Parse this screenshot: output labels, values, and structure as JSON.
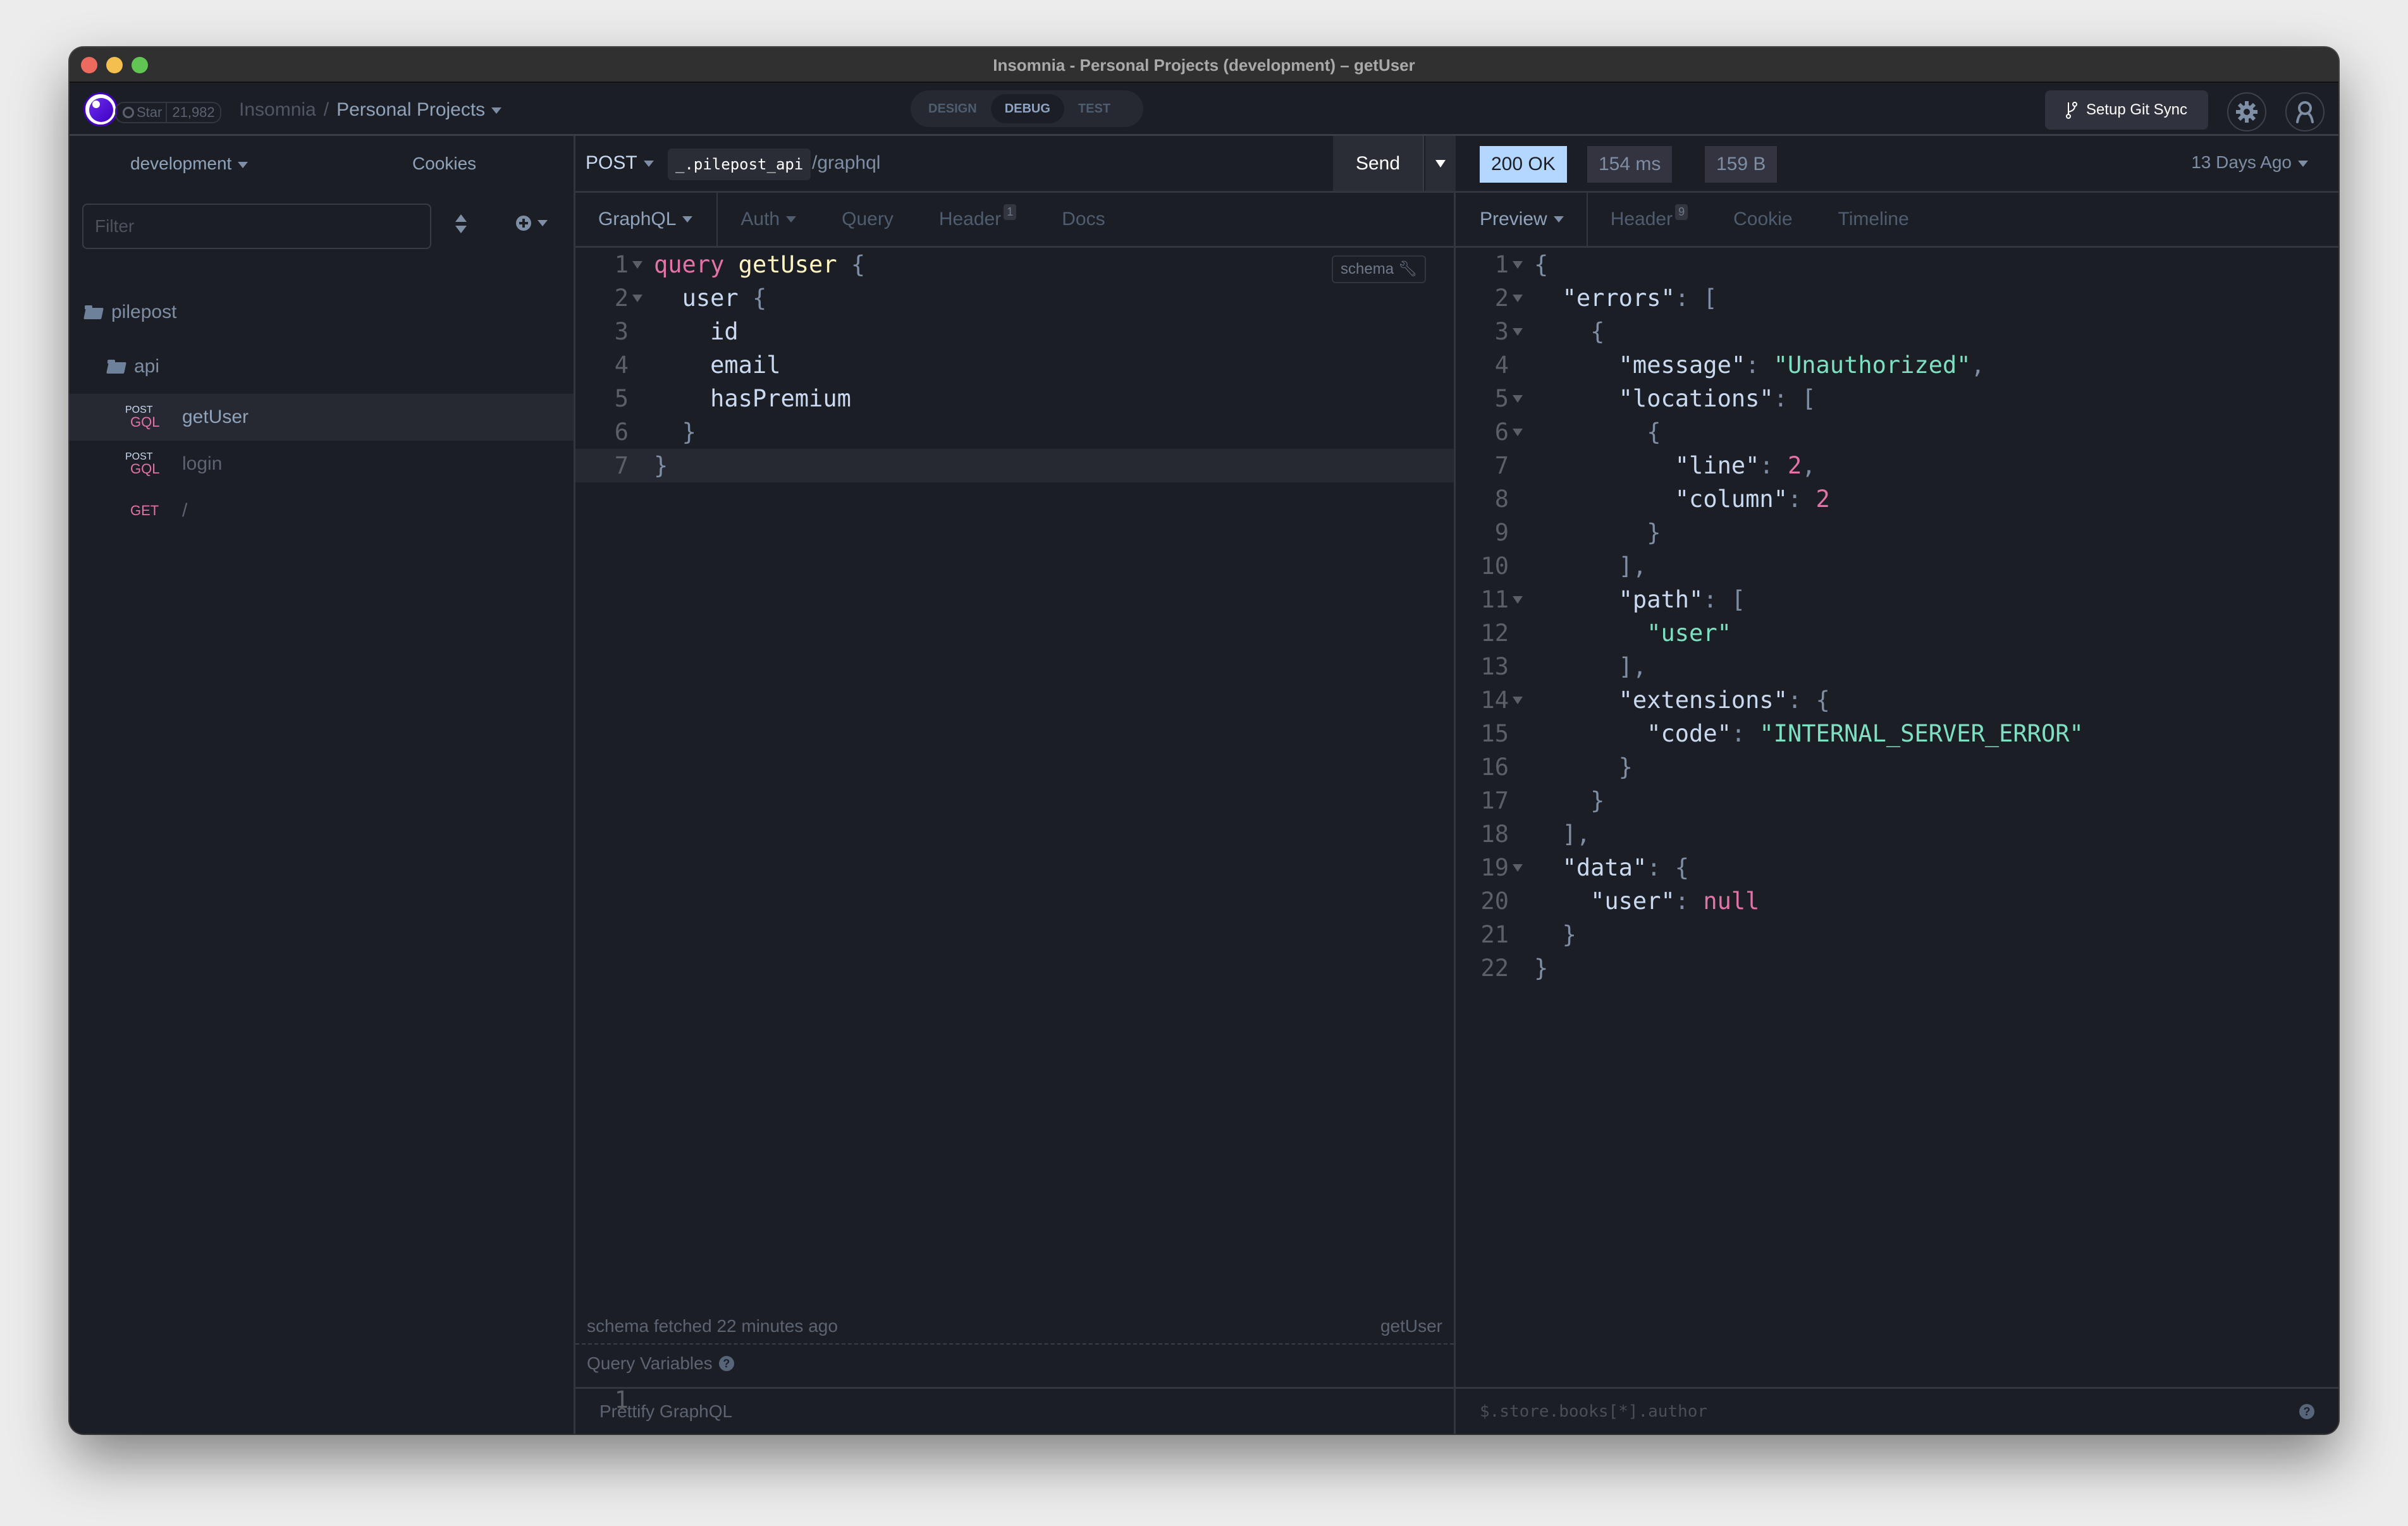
{
  "window": {
    "title": "Insomnia - Personal Projects (development) – getUser"
  },
  "header": {
    "github": {
      "label": "Star",
      "count": "21,982"
    },
    "breadcrumb": {
      "root": "Insomnia",
      "separator": "/",
      "current": "Personal Projects"
    },
    "modes": [
      {
        "label": "DESIGN",
        "active": false
      },
      {
        "label": "DEBUG",
        "active": true
      },
      {
        "label": "TEST",
        "active": false
      }
    ],
    "git_sync_label": "Setup Git Sync",
    "settings_icon": "gear-icon",
    "account_icon": "user-icon"
  },
  "sidebar": {
    "environment": "development",
    "cookies_label": "Cookies",
    "filter_placeholder": "Filter",
    "tree": {
      "workspace_folder": "pilepost",
      "sub_folder": "api",
      "requests": [
        {
          "method_top": "POST",
          "method_bottom": "GQL",
          "name": "getUser",
          "active": true
        },
        {
          "method_top": "POST",
          "method_bottom": "GQL",
          "name": "login",
          "active": false
        },
        {
          "method_top": "",
          "method_bottom": "GET",
          "name": "/",
          "active": false
        }
      ]
    }
  },
  "request": {
    "method": "POST",
    "env_var": "_.pilepost_api",
    "path": "/graphql",
    "send_label": "Send",
    "tabs": [
      {
        "label": "GraphQL",
        "dropdown": true
      },
      {
        "label": "Auth",
        "dropdown": true
      },
      {
        "label": "Query"
      },
      {
        "label": "Header",
        "badge": "1"
      },
      {
        "label": "Docs"
      }
    ],
    "schema_label": "schema",
    "code": [
      {
        "n": "1",
        "fold": true,
        "tokens": [
          [
            "kw",
            "query"
          ],
          [
            "p",
            " "
          ],
          [
            "fn",
            "getUser"
          ],
          [
            "p",
            " "
          ],
          [
            "punc",
            "{"
          ]
        ]
      },
      {
        "n": "2",
        "fold": true,
        "tokens": [
          [
            "p",
            "  "
          ],
          [
            "prop",
            "user"
          ],
          [
            "p",
            " "
          ],
          [
            "punc",
            "{"
          ]
        ]
      },
      {
        "n": "3",
        "fold": false,
        "tokens": [
          [
            "p",
            "    "
          ],
          [
            "prop",
            "id"
          ]
        ]
      },
      {
        "n": "4",
        "fold": false,
        "tokens": [
          [
            "p",
            "    "
          ],
          [
            "prop",
            "email"
          ]
        ]
      },
      {
        "n": "5",
        "fold": false,
        "tokens": [
          [
            "p",
            "    "
          ],
          [
            "prop",
            "hasPremium"
          ]
        ]
      },
      {
        "n": "6",
        "fold": false,
        "tokens": [
          [
            "p",
            "  "
          ],
          [
            "punc",
            "}"
          ]
        ]
      },
      {
        "n": "7",
        "fold": false,
        "current": true,
        "tokens": [
          [
            "punc",
            "}"
          ]
        ]
      }
    ],
    "schema_status": "schema fetched 22 minutes ago",
    "operation_name": "getUser",
    "query_variables_label": "Query Variables",
    "query_variables_line": "1",
    "prettify_label": "Prettify GraphQL"
  },
  "response": {
    "status": "200 OK",
    "time": "154 ms",
    "size": "159 B",
    "history": "13 Days Ago",
    "status_color": "#b3d7ff",
    "tabs": [
      {
        "label": "Preview",
        "dropdown": true
      },
      {
        "label": "Header",
        "badge": "9"
      },
      {
        "label": "Cookie"
      },
      {
        "label": "Timeline"
      }
    ],
    "code": [
      {
        "n": "1",
        "fold": true,
        "tokens": [
          [
            "punc",
            "{"
          ]
        ]
      },
      {
        "n": "2",
        "fold": true,
        "tokens": [
          [
            "p",
            "  "
          ],
          [
            "prop",
            "\"errors\""
          ],
          [
            "punc",
            ": ["
          ]
        ]
      },
      {
        "n": "3",
        "fold": true,
        "tokens": [
          [
            "p",
            "    "
          ],
          [
            "punc",
            "{"
          ]
        ]
      },
      {
        "n": "4",
        "fold": false,
        "tokens": [
          [
            "p",
            "      "
          ],
          [
            "prop",
            "\"message\""
          ],
          [
            "punc",
            ": "
          ],
          [
            "str",
            "\"Unauthorized\""
          ],
          [
            "punc",
            ","
          ]
        ]
      },
      {
        "n": "5",
        "fold": true,
        "tokens": [
          [
            "p",
            "      "
          ],
          [
            "prop",
            "\"locations\""
          ],
          [
            "punc",
            ": ["
          ]
        ]
      },
      {
        "n": "6",
        "fold": true,
        "tokens": [
          [
            "p",
            "        "
          ],
          [
            "punc",
            "{"
          ]
        ]
      },
      {
        "n": "7",
        "fold": false,
        "tokens": [
          [
            "p",
            "          "
          ],
          [
            "prop",
            "\"line\""
          ],
          [
            "punc",
            ": "
          ],
          [
            "num",
            "2"
          ],
          [
            "punc",
            ","
          ]
        ]
      },
      {
        "n": "8",
        "fold": false,
        "tokens": [
          [
            "p",
            "          "
          ],
          [
            "prop",
            "\"column\""
          ],
          [
            "punc",
            ": "
          ],
          [
            "num",
            "2"
          ]
        ]
      },
      {
        "n": "9",
        "fold": false,
        "tokens": [
          [
            "p",
            "        "
          ],
          [
            "punc",
            "}"
          ]
        ]
      },
      {
        "n": "10",
        "fold": false,
        "tokens": [
          [
            "p",
            "      "
          ],
          [
            "punc",
            "],"
          ]
        ]
      },
      {
        "n": "11",
        "fold": true,
        "tokens": [
          [
            "p",
            "      "
          ],
          [
            "prop",
            "\"path\""
          ],
          [
            "punc",
            ": ["
          ]
        ]
      },
      {
        "n": "12",
        "fold": false,
        "tokens": [
          [
            "p",
            "        "
          ],
          [
            "str",
            "\"user\""
          ]
        ]
      },
      {
        "n": "13",
        "fold": false,
        "tokens": [
          [
            "p",
            "      "
          ],
          [
            "punc",
            "],"
          ]
        ]
      },
      {
        "n": "14",
        "fold": true,
        "tokens": [
          [
            "p",
            "      "
          ],
          [
            "prop",
            "\"extensions\""
          ],
          [
            "punc",
            ": {"
          ]
        ]
      },
      {
        "n": "15",
        "fold": false,
        "tokens": [
          [
            "p",
            "        "
          ],
          [
            "prop",
            "\"code\""
          ],
          [
            "punc",
            ": "
          ],
          [
            "str",
            "\"INTERNAL_SERVER_ERROR\""
          ]
        ]
      },
      {
        "n": "16",
        "fold": false,
        "tokens": [
          [
            "p",
            "      "
          ],
          [
            "punc",
            "}"
          ]
        ]
      },
      {
        "n": "17",
        "fold": false,
        "tokens": [
          [
            "p",
            "    "
          ],
          [
            "punc",
            "}"
          ]
        ]
      },
      {
        "n": "18",
        "fold": false,
        "tokens": [
          [
            "p",
            "  "
          ],
          [
            "punc",
            "],"
          ]
        ]
      },
      {
        "n": "19",
        "fold": true,
        "tokens": [
          [
            "p",
            "  "
          ],
          [
            "prop",
            "\"data\""
          ],
          [
            "punc",
            ": {"
          ]
        ]
      },
      {
        "n": "20",
        "fold": false,
        "tokens": [
          [
            "p",
            "    "
          ],
          [
            "prop",
            "\"user\""
          ],
          [
            "punc",
            ": "
          ],
          [
            "num",
            "null"
          ]
        ]
      },
      {
        "n": "21",
        "fold": false,
        "tokens": [
          [
            "p",
            "  "
          ],
          [
            "punc",
            "}"
          ]
        ]
      },
      {
        "n": "22",
        "fold": false,
        "tokens": [
          [
            "punc",
            "}"
          ]
        ]
      }
    ],
    "filter_placeholder": "$.store.books[*].author"
  }
}
